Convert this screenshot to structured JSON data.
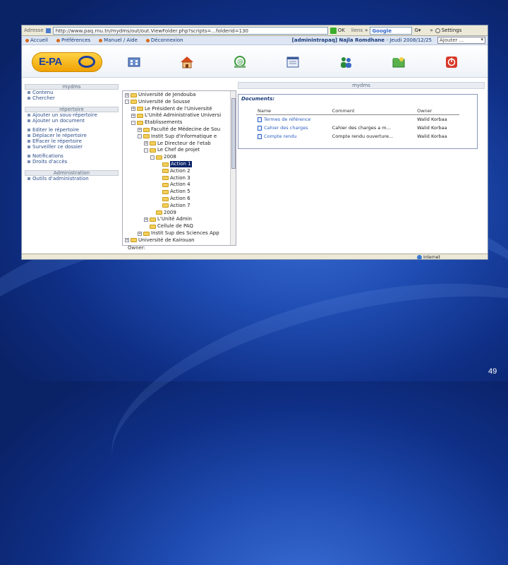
{
  "browser": {
    "address_label": "Adresse",
    "url": "http://www.paq.rnu.tn/mydms/out/out.ViewFolder.php?scripts=...folderid=130",
    "go_label": "OK",
    "links_label": "liens",
    "search_engine": "Google",
    "settings_label": "Settings"
  },
  "menu": {
    "items": [
      "Accueil",
      "Préférences",
      "Manuel / Aide",
      "Déconnexion"
    ],
    "user": "[adminintrapaq] Najla Romdhane",
    "date": "- Jeudi 2008/12/25",
    "jump_placeholder": "Ajouter ..."
  },
  "logo": {
    "text": "E-PA"
  },
  "nav_icons": [
    "organization-icon",
    "home-icon",
    "mail-icon",
    "document-icon",
    "users-icon",
    "folder-icon",
    "power-icon"
  ],
  "sidebar": {
    "title": "mydms",
    "top_items": [
      "Contenu",
      "Chercher"
    ],
    "repertoire_title": "répertoire",
    "repertoire_items": [
      "Ajouter un sous-répertoire",
      "Ajouter un document",
      "Editer le répertoire",
      "Déplacer le répertoire",
      "Effacer le répertoire",
      "Surveiller ce dossier",
      "Notifications",
      "Droits d'accès"
    ],
    "admin_title": "Administration",
    "admin_items": [
      "Outils d'administration"
    ]
  },
  "tree": [
    {
      "label": "Université de Jendouba",
      "level": 0,
      "toggle": "+"
    },
    {
      "label": "Université de Sousse",
      "level": 0,
      "toggle": "-"
    },
    {
      "label": "Le Président de l'Université",
      "level": 1,
      "toggle": "+"
    },
    {
      "label": "L'Unité Administrative Universi",
      "level": 1,
      "toggle": "+"
    },
    {
      "label": "Etablissements",
      "level": 1,
      "toggle": "-"
    },
    {
      "label": "Faculté de Médecine de Sou",
      "level": 2,
      "toggle": "+"
    },
    {
      "label": "Instit Sup d'Informatique e",
      "level": 2,
      "toggle": "-"
    },
    {
      "label": "Le Directeur de l'etab",
      "level": 3,
      "toggle": "+"
    },
    {
      "label": "Le Chef de projet",
      "level": 3,
      "toggle": "-"
    },
    {
      "label": "2008",
      "level": 4,
      "toggle": "-"
    },
    {
      "label": "Action 1",
      "level": 5,
      "toggle": "",
      "selected": true
    },
    {
      "label": "Action 2",
      "level": 5,
      "toggle": ""
    },
    {
      "label": "Action 3",
      "level": 5,
      "toggle": ""
    },
    {
      "label": "Action 4",
      "level": 5,
      "toggle": ""
    },
    {
      "label": "Action 5",
      "level": 5,
      "toggle": ""
    },
    {
      "label": "Action 6",
      "level": 5,
      "toggle": ""
    },
    {
      "label": "Action 7",
      "level": 5,
      "toggle": ""
    },
    {
      "label": "2009",
      "level": 4,
      "toggle": ""
    },
    {
      "label": "L'Unité Admin",
      "level": 3,
      "toggle": "+"
    },
    {
      "label": "Cellule de PAQ",
      "level": 3,
      "toggle": ""
    },
    {
      "label": "Instit Sup des Sciences App",
      "level": 2,
      "toggle": "+"
    },
    {
      "label": "Université de Kairouan",
      "level": 0,
      "toggle": "+"
    }
  ],
  "main": {
    "title": "mydms",
    "panel_title": "Documents:",
    "columns": [
      "Name",
      "Comment",
      "Owner"
    ],
    "rows": [
      {
        "name": "Termes de référence",
        "comment": "",
        "owner": "Walid Korbaa"
      },
      {
        "name": "Cahier des charges",
        "comment": "Cahier des charges a m...",
        "owner": "Walid Korbaa"
      },
      {
        "name": "Compte rendu",
        "comment": "Compte rendu ouverture...",
        "owner": "Walid Korbaa"
      }
    ],
    "owner_label": "Owner:"
  },
  "status": {
    "zone": "Internet"
  },
  "slide": {
    "page_number": "49"
  }
}
